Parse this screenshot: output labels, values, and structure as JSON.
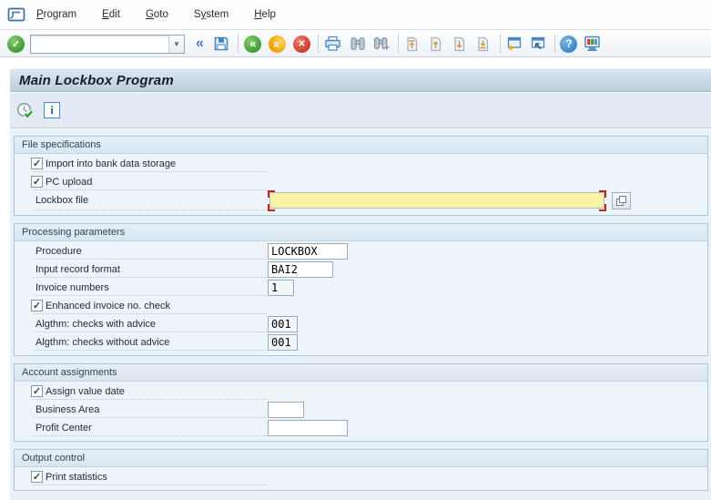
{
  "menu_bar": {
    "items": [
      {
        "pre": "",
        "key": "P",
        "post": "rogram"
      },
      {
        "pre": "",
        "key": "E",
        "post": "dit"
      },
      {
        "pre": "",
        "key": "G",
        "post": "oto"
      },
      {
        "pre": "S",
        "key": "y",
        "post": "stem"
      },
      {
        "pre": "",
        "key": "H",
        "post": "elp"
      }
    ]
  },
  "toolbar": {
    "command_field": {
      "value": "",
      "placeholder": ""
    },
    "icons": [
      "enter-icon",
      "command-dropdown-icon",
      "collapse-icon",
      "save-icon",
      "back-icon",
      "exit-icon",
      "cancel-icon",
      "print-icon",
      "find-icon",
      "find-next-icon",
      "first-page-icon",
      "page-up-icon",
      "page-down-icon",
      "last-page-icon",
      "new-session-icon",
      "create-shortcut-icon",
      "help-icon",
      "customize-layout-icon"
    ]
  },
  "header": {
    "title": "Main Lockbox Program"
  },
  "app_toolbar": {
    "icons": [
      "execute-icon",
      "info-icon"
    ]
  },
  "sections": {
    "file_specifications": {
      "title": "File specifications",
      "import_checkbox": {
        "label": "Import into bank data storage",
        "checked": true
      },
      "pc_upload_checkbox": {
        "label": "PC upload",
        "checked": true
      },
      "lockbox_file": {
        "label": "Lockbox file",
        "value": "",
        "required": true
      }
    },
    "processing_parameters": {
      "title": "Processing parameters",
      "procedure": {
        "label": "Procedure",
        "value": "LOCKBOX"
      },
      "input_record_format": {
        "label": "Input record format",
        "value": "BAI2"
      },
      "invoice_numbers": {
        "label": "Invoice numbers",
        "value": "1"
      },
      "enhanced_check_checkbox": {
        "label": "Enhanced invoice no. check",
        "checked": true
      },
      "algthm_with_advice": {
        "label": "Algthm: checks with advice",
        "value": "001"
      },
      "algthm_without_advice": {
        "label": "Algthm: checks without advice",
        "value": "001"
      }
    },
    "account_assignments": {
      "title": "Account assignments",
      "assign_value_date_checkbox": {
        "label": "Assign value date",
        "checked": true
      },
      "business_area": {
        "label": "Business Area",
        "value": ""
      },
      "profit_center": {
        "label": "Profit Center",
        "value": ""
      }
    },
    "output_control": {
      "title": "Output control",
      "print_statistics_checkbox": {
        "label": "Print statistics",
        "checked": true
      }
    }
  },
  "colors": {
    "required_field_bg": "#fbf3a4",
    "required_marker": "#c8231d",
    "enter_green": "#3f9b34",
    "exit_orange": "#ee9e00",
    "cancel_red": "#ce3a2b",
    "icon_blue": "#4a86c2",
    "title_bar_top": "#dde7f0",
    "title_bar_bottom": "#bccddd",
    "content_bg": "#e8f0f8"
  }
}
